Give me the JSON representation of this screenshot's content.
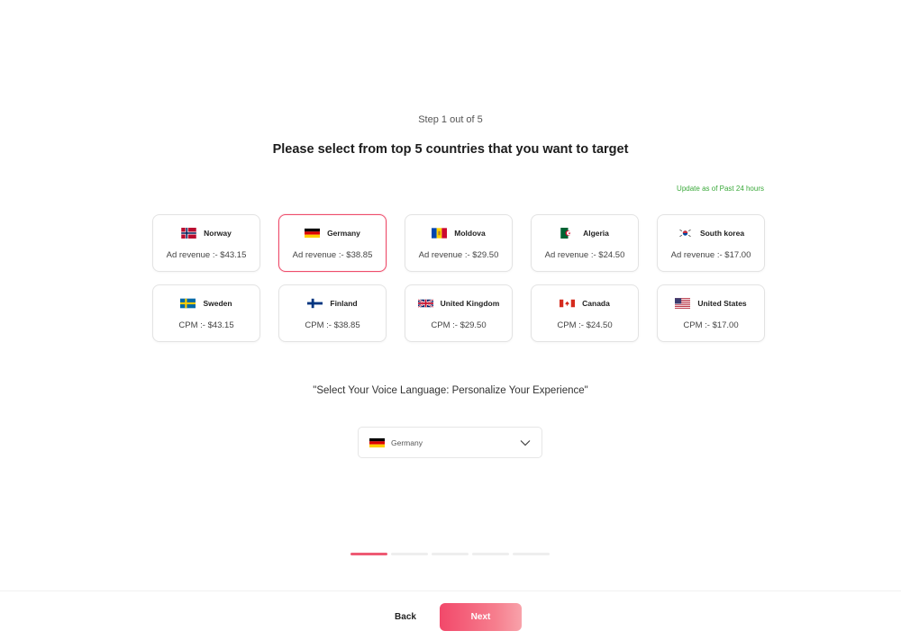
{
  "header": {
    "step_label": "Step 1 out of 5",
    "title": "Please select from top 5 countries that you want to target",
    "update_note": "Update as of Past 24 hours"
  },
  "countries": [
    {
      "name": "Norway",
      "flag": "norway-flag",
      "metric": "Ad revenue :- $43.15",
      "selected": false
    },
    {
      "name": "Germany",
      "flag": "germany-flag",
      "metric": "Ad revenue :- $38.85",
      "selected": true
    },
    {
      "name": "Moldova",
      "flag": "moldova-flag",
      "metric": "Ad revenue :- $29.50",
      "selected": false
    },
    {
      "name": "Algeria",
      "flag": "algeria-flag",
      "metric": "Ad revenue :- $24.50",
      "selected": false
    },
    {
      "name": "South korea",
      "flag": "south-korea-flag",
      "metric": "Ad revenue :- $17.00",
      "selected": false
    },
    {
      "name": "Sweden",
      "flag": "sweden-flag",
      "metric": "CPM :- $43.15",
      "selected": false
    },
    {
      "name": "Finland",
      "flag": "finland-flag",
      "metric": "CPM :- $38.85",
      "selected": false
    },
    {
      "name": "United Kingdom",
      "flag": "uk-flag",
      "metric": "CPM :- $29.50",
      "selected": false
    },
    {
      "name": "Canada",
      "flag": "canada-flag",
      "metric": "CPM :- $24.50",
      "selected": false
    },
    {
      "name": "United States",
      "flag": "us-flag",
      "metric": "CPM :- $17.00",
      "selected": false
    }
  ],
  "voice": {
    "title": "\"Select Your Voice Language: Personalize Your Experience\"",
    "selected_value": "Germany",
    "selected_flag": "germany-flag"
  },
  "progress": {
    "current_step": 1,
    "total_steps": 5
  },
  "footer": {
    "back_label": "Back",
    "next_label": "Next"
  },
  "colors": {
    "accent": "#ee4d6b",
    "update_note": "#3aa93a",
    "next_gradient_start": "#f2486a",
    "next_gradient_end": "#f8a2aa"
  }
}
